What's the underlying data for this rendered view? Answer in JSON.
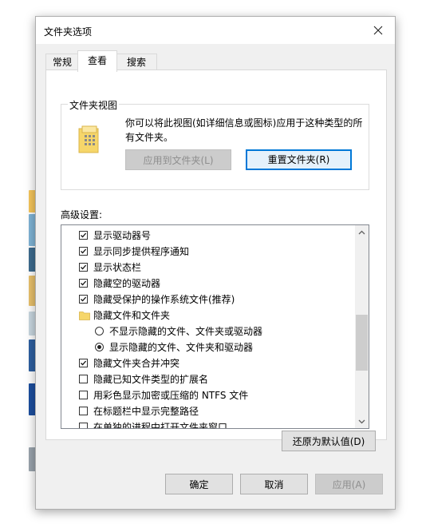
{
  "dialog": {
    "title": "文件夹选项"
  },
  "tabs": [
    {
      "label": "常规",
      "active": false
    },
    {
      "label": "查看",
      "active": true
    },
    {
      "label": "搜索",
      "active": false
    }
  ],
  "folder_views": {
    "legend": "文件夹视图",
    "description": "你可以将此视图(如详细信息或图标)应用于这种类型的所有文件夹。",
    "apply_button": "应用到文件夹(L)",
    "reset_button": "重置文件夹(R)"
  },
  "advanced": {
    "label": "高级设置:",
    "items": [
      {
        "type": "checkbox",
        "checked": true,
        "indent": 0,
        "label": "显示驱动器号"
      },
      {
        "type": "checkbox",
        "checked": true,
        "indent": 0,
        "label": "显示同步提供程序通知"
      },
      {
        "type": "checkbox",
        "checked": true,
        "indent": 0,
        "label": "显示状态栏"
      },
      {
        "type": "checkbox",
        "checked": true,
        "indent": 0,
        "label": "隐藏空的驱动器"
      },
      {
        "type": "checkbox",
        "checked": true,
        "indent": 0,
        "label": "隐藏受保护的操作系统文件(推荐)"
      },
      {
        "type": "folder",
        "checked": false,
        "indent": 0,
        "label": "隐藏文件和文件夹"
      },
      {
        "type": "radio",
        "checked": false,
        "indent": 1,
        "label": "不显示隐藏的文件、文件夹或驱动器"
      },
      {
        "type": "radio",
        "checked": true,
        "indent": 1,
        "label": "显示隐藏的文件、文件夹和驱动器"
      },
      {
        "type": "checkbox",
        "checked": true,
        "indent": 0,
        "label": "隐藏文件夹合并冲突"
      },
      {
        "type": "checkbox",
        "checked": false,
        "indent": 0,
        "label": "隐藏已知文件类型的扩展名"
      },
      {
        "type": "checkbox",
        "checked": false,
        "indent": 0,
        "label": "用彩色显示加密或压缩的 NTFS 文件"
      },
      {
        "type": "checkbox",
        "checked": false,
        "indent": 0,
        "label": "在标题栏中显示完整路径"
      },
      {
        "type": "checkbox",
        "checked": false,
        "indent": 0,
        "label": "在单独的进程中打开文件夹窗口"
      }
    ],
    "restore_button": "还原为默认值(D)"
  },
  "footer": {
    "ok": "确定",
    "cancel": "取消",
    "apply": "应用(A)"
  },
  "colors": {
    "focus": "#0078d7",
    "folder": "#f6d66a"
  }
}
